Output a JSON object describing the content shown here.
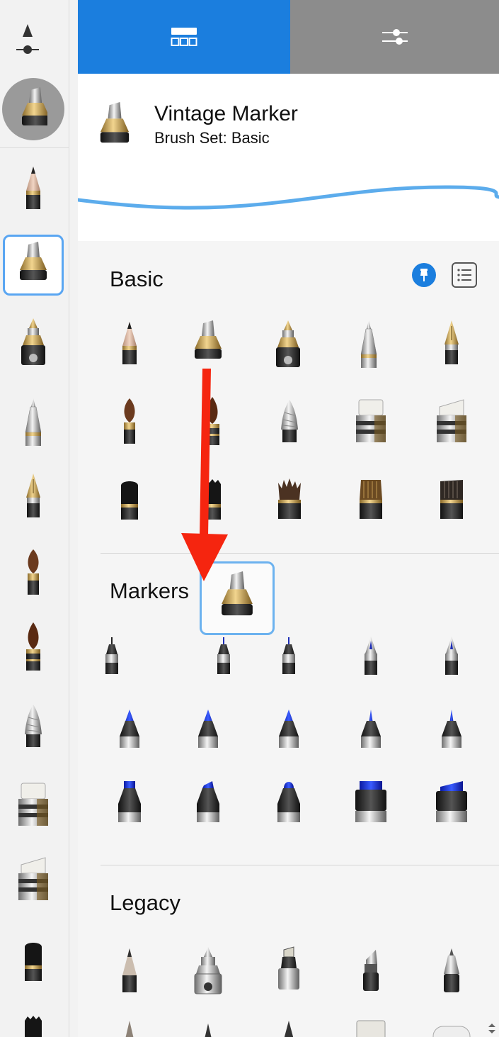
{
  "tabs": {
    "brushes_icon": "brush-library-icon",
    "settings_icon": "sliders-icon",
    "active_color": "#1b7ede",
    "inactive_color": "#8c8c8c"
  },
  "current_brush": {
    "name": "Vintage Marker",
    "set_label": "Brush Set: Basic",
    "stroke_color": "#4aa3ea"
  },
  "sections": {
    "basic": {
      "title": "Basic"
    },
    "markers": {
      "title": "Markers"
    },
    "legacy": {
      "title": "Legacy"
    }
  },
  "annotation": {
    "arrow_color": "#f5250f"
  }
}
